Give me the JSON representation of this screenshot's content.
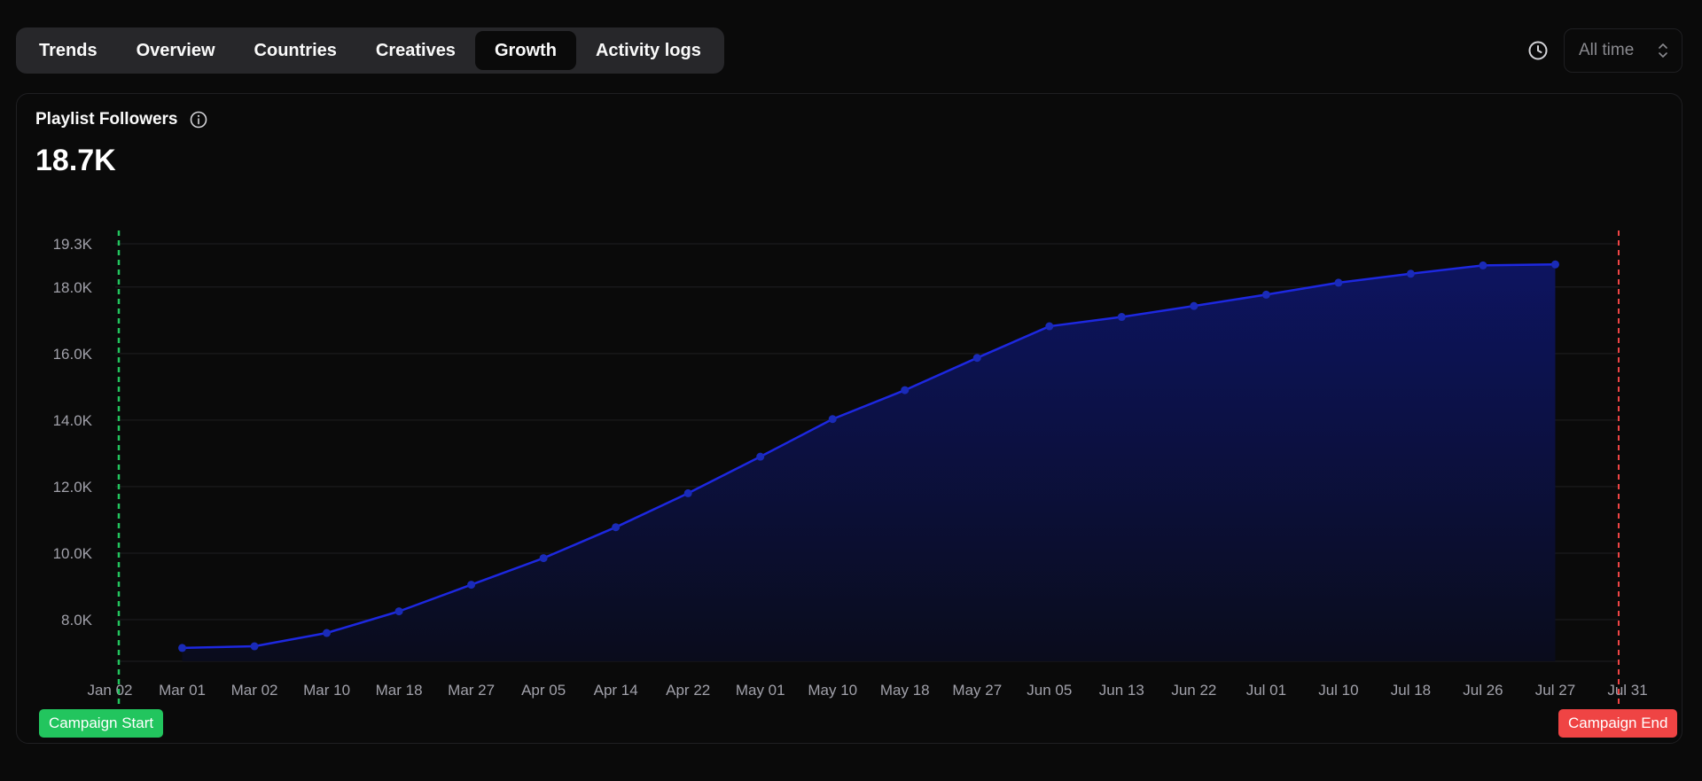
{
  "tabs": [
    {
      "label": "Trends"
    },
    {
      "label": "Overview"
    },
    {
      "label": "Countries"
    },
    {
      "label": "Creatives"
    },
    {
      "label": "Growth",
      "active": true
    },
    {
      "label": "Activity logs"
    }
  ],
  "range_selector": {
    "label": "All time",
    "icon": "clock-icon"
  },
  "card": {
    "title": "Playlist Followers",
    "value": "18.7K",
    "info_icon": "info-icon"
  },
  "markers": {
    "start_label": "Campaign Start",
    "end_label": "Campaign End",
    "start_color": "#22c55e",
    "end_color": "#ef4444"
  },
  "colors": {
    "line": "#1d28e0",
    "fill_top": "#0d1460",
    "fill_bottom": "#0a0c1c"
  },
  "chart_data": {
    "type": "area",
    "title": "Playlist Followers",
    "x": [
      "Jan 02",
      "Mar 01",
      "Mar 02",
      "Mar 10",
      "Mar 18",
      "Mar 27",
      "Apr 05",
      "Apr 14",
      "Apr 22",
      "May 01",
      "May 10",
      "May 18",
      "May 27",
      "Jun 05",
      "Jun 13",
      "Jun 22",
      "Jul 01",
      "Jul 10",
      "Jul 18",
      "Jul 26",
      "Jul 27",
      "Jul 31"
    ],
    "series": [
      {
        "values": [
          null,
          7150,
          7200,
          7600,
          8250,
          9050,
          9850,
          10780,
          11800,
          12900,
          14030,
          14900,
          15870,
          16820,
          17100,
          17430,
          17770,
          18130,
          18400,
          18650,
          18680,
          null
        ]
      }
    ],
    "y_ticks": [
      "19.3K",
      "18.0K",
      "16.0K",
      "14.0K",
      "12.0K",
      "10.0K",
      "8.0K"
    ],
    "y_tick_values": [
      19300,
      18000,
      16000,
      14000,
      12000,
      10000,
      8000
    ],
    "ylim": [
      6700,
      19300
    ],
    "grid": true,
    "annotations": [
      {
        "label": "Campaign Start",
        "at": "Jan 02",
        "style": "dashed-vertical"
      },
      {
        "label": "Campaign End",
        "at": "Jul 31",
        "style": "dashed-vertical"
      }
    ]
  }
}
